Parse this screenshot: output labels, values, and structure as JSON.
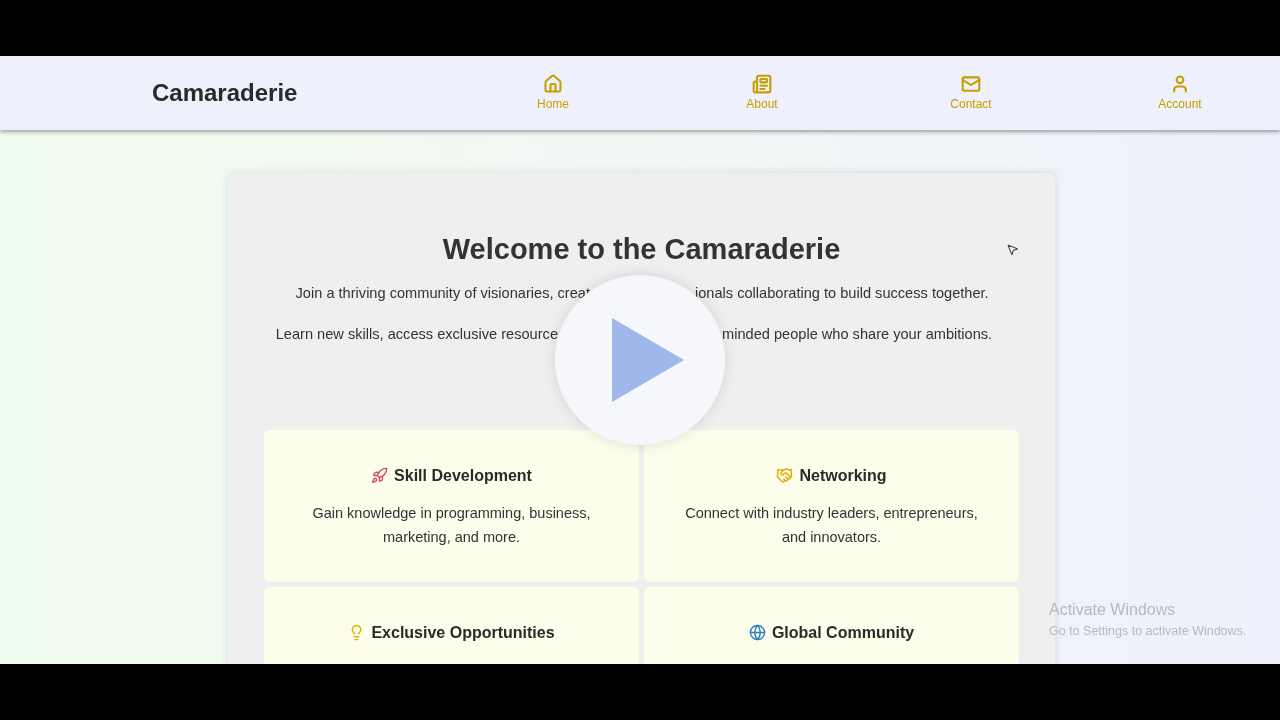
{
  "navbar": {
    "brand": "Camaraderie",
    "items": [
      {
        "label": "Home"
      },
      {
        "label": "About"
      },
      {
        "label": "Contact"
      },
      {
        "label": "Account"
      }
    ]
  },
  "hero": {
    "title": "Welcome to the Camaraderie",
    "lines": [
      {
        "before": "Join a thriving community of visionaries, creat",
        "after": "ionals collaborating to build success together."
      },
      {
        "before": "Learn new skills, access exclusive resource",
        "after": "minded people who share your ambitions."
      }
    ]
  },
  "features": [
    {
      "title": "Skill Development",
      "text": "Gain knowledge in programming, business, marketing, and more."
    },
    {
      "title": "Networking",
      "text": "Connect with industry leaders, entrepreneurs, and innovators."
    },
    {
      "title": "Exclusive Opportunities"
    },
    {
      "title": "Global Community"
    }
  ],
  "os_notice": {
    "title": "Activate Windows",
    "text": "Go to Settings to activate Windows."
  }
}
